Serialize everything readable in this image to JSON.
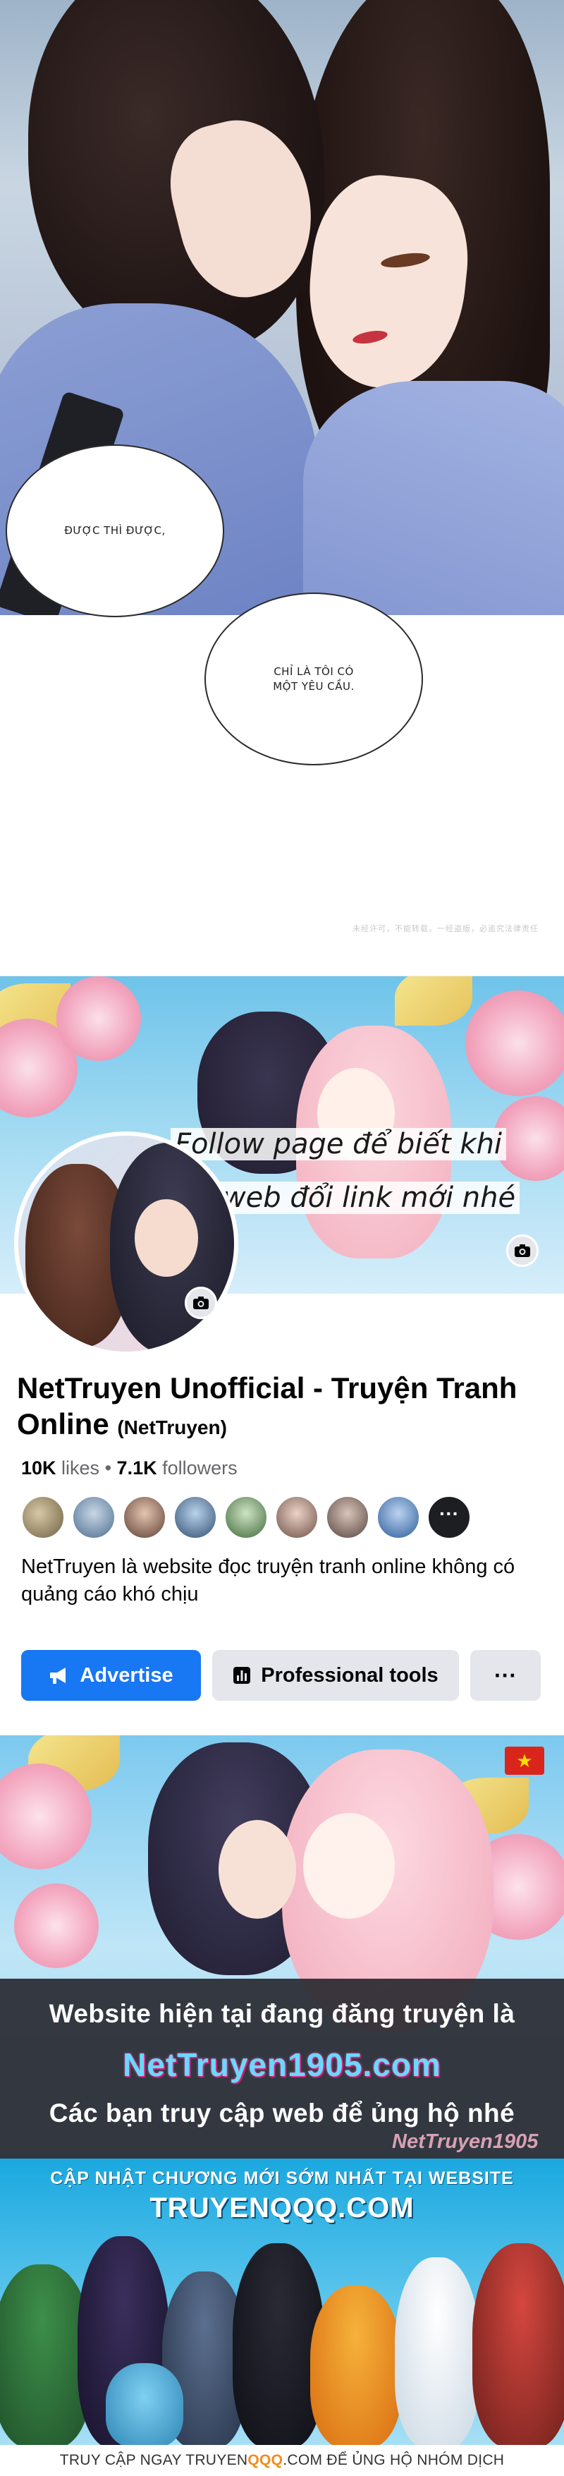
{
  "manga": {
    "bubble_1": "ĐƯỢC THÌ ĐƯỢC,",
    "bubble_2_line1": "CHỈ LÀ TÔI CÓ",
    "bubble_2_line2": "MỘT YÊU CẦU.",
    "watermark": "未经许可，不能转载。一经盗版，必追究法律责任"
  },
  "facebook_page": {
    "cover_text_line1": "Follow page để biết khi",
    "cover_text_line2": "nào web đổi link mới nhé",
    "page_name": "NetTruyen Unofficial - Truyện Tranh Online",
    "handle": "(NetTruyen)",
    "likes_count": "10K",
    "likes_label": "likes",
    "followers_count": "7.1K",
    "followers_label": "followers",
    "separator": "•",
    "friends_more_label": "···",
    "description": "NetTruyen là website đọc truyện tranh online không có quảng cáo khó chịu",
    "actions": {
      "advertise": "Advertise",
      "professional_tools": "Professional tools",
      "more": "···"
    },
    "icons": {
      "cover_camera": "camera-icon",
      "avatar_camera": "camera-icon",
      "advertise": "megaphone-icon",
      "tools": "chart-icon"
    }
  },
  "nettruyen_banner": {
    "line1": "Website hiện tại đang đăng truyện là",
    "url": "NetTruyen1905.com",
    "line3": "Các bạn truy cập web để ủng hộ nhé",
    "watermark": "NetTruyen1905",
    "flag_symbol": "★"
  },
  "truyenqq_banner": {
    "title": "CẬP NHẬT CHƯƠNG MỚI SỚM NHẤT TẠI WEBSITE",
    "brand": "TRUYENQQQ.COM",
    "footer_prefix": "TRUY CẬP NGAY TRUYEN",
    "footer_highlight": "QQQ",
    "footer_suffix": ".COM ĐỂ ỦNG HỘ NHÓM DỊCH"
  },
  "colors": {
    "facebook_blue": "#1877f2",
    "button_gray": "#e4e6eb",
    "url_cyan": "#6ad9ff",
    "footer_highlight": "#f28c1a"
  }
}
